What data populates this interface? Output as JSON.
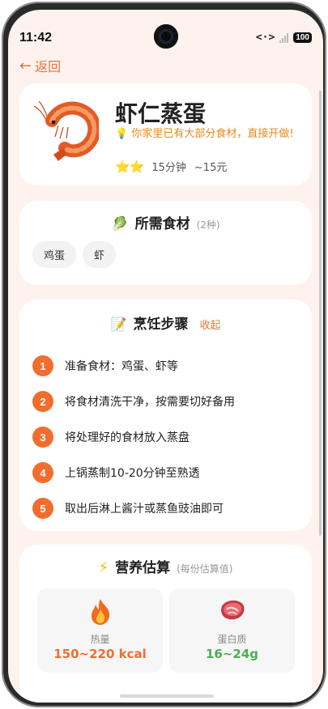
{
  "status": {
    "time": "11:42",
    "link_icon": "<·>",
    "battery": "100"
  },
  "nav": {
    "back_label": "返回"
  },
  "recipe": {
    "title": "虾仁蒸蛋",
    "tip": "💡 你家里已有大部分食材，直接开做!",
    "stars": "⭐⭐",
    "time": "15分钟",
    "cost": "~15元",
    "image_icon": "shrimp-icon"
  },
  "ingredients": {
    "emoji": "🥬",
    "title": "所需食材",
    "count": "(2种)",
    "items": [
      "鸡蛋",
      "虾"
    ]
  },
  "steps": {
    "emoji": "📝",
    "title": "烹饪步骤",
    "collapse_label": "收起",
    "items": [
      {
        "num": "1",
        "text": "准备食材：鸡蛋、虾等"
      },
      {
        "num": "2",
        "text": "将食材清洗干净，按需要切好备用"
      },
      {
        "num": "3",
        "text": "将处理好的食材放入蒸盘"
      },
      {
        "num": "4",
        "text": "上锅蒸制10-20分钟至熟透"
      },
      {
        "num": "5",
        "text": "取出后淋上酱汁或蒸鱼豉油即可"
      }
    ]
  },
  "nutrition": {
    "emoji": "⚡",
    "title": "营养估算",
    "subtitle": "(每份估算值)",
    "items": [
      {
        "icon": "🔥",
        "label": "热量",
        "value": "150~220 kcal",
        "color": "#f26d2d"
      },
      {
        "icon": "🥩",
        "label": "蛋白质",
        "value": "16~24g",
        "color": "#4caf50"
      }
    ]
  },
  "colors": {
    "accent": "#e8733c",
    "background": "#fdf2ed",
    "tip": "#e58a1f"
  }
}
